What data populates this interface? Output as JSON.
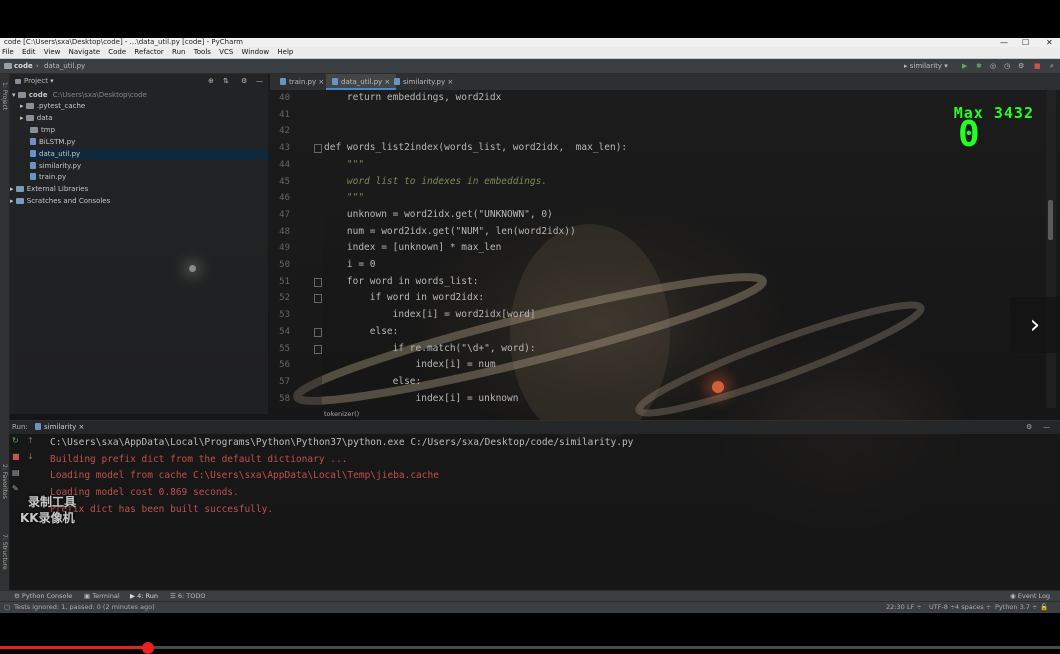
{
  "window": {
    "title": "code [C:\\Users\\sxa\\Desktop\\code] - ...\\data_util.py [code] - PyCharm",
    "controls": [
      "—",
      "☐",
      "✕"
    ]
  },
  "menu": [
    "File",
    "Edit",
    "View",
    "Navigate",
    "Code",
    "Refactor",
    "Run",
    "Tools",
    "VCS",
    "Window",
    "Help"
  ],
  "nav": {
    "breadcrumb": [
      "code",
      "data_util.py"
    ],
    "run_config": "similarity"
  },
  "project": {
    "header": "Project",
    "root_name": "code",
    "root_path": "C:\\Users\\sxa\\Desktop\\code",
    "items": [
      ".pytest_cache",
      "data",
      "tmp",
      "BiLSTM.py",
      "data_util.py",
      "similarity.py",
      "train.py"
    ],
    "external": "External Libraries",
    "scratches": "Scratches and Consoles"
  },
  "tabs": [
    "train.py",
    "data_util.py",
    "similarity.py"
  ],
  "editor": {
    "line_numbers": [
      "40",
      "41",
      "42",
      "43",
      "44",
      "45",
      "46",
      "47",
      "48",
      "49",
      "50",
      "51",
      "52",
      "53",
      "54",
      "55",
      "56",
      "57",
      "58"
    ],
    "lines": [
      "    return embeddings, word2idx",
      "",
      "",
      "def words_list2index(words_list, word2idx,  max_len):",
      "    \"\"\"",
      "    word list to indexes in embeddings.",
      "    \"\"\"",
      "    unknown = word2idx.get(\"UNKNOWN\", 0)",
      "    num = word2idx.get(\"NUM\", len(word2idx))",
      "    index = [unknown] * max_len",
      "    i = 0",
      "    for word in words_list:",
      "        if word in word2idx:",
      "            index[i] = word2idx[word]",
      "        else:",
      "            if re.match(\"\\d+\", word):",
      "                index[i] = num",
      "            else:",
      "                index[i] = unknown"
    ],
    "breadcrumb_bottom": "tokenizer()"
  },
  "run": {
    "label": "Run:",
    "config": "similarity",
    "output": [
      {
        "text": "C:\\Users\\sxa\\AppData\\Local\\Programs\\Python\\Python37\\python.exe C:/Users/sxa/Desktop/code/similarity.py",
        "color": "#bdbdbd"
      },
      {
        "text": "Building prefix dict from the default dictionary ...",
        "color": "#c0504d"
      },
      {
        "text": "Loading model from cache C:\\Users\\sxa\\AppData\\Local\\Temp\\jieba.cache",
        "color": "#c0504d"
      },
      {
        "text": "Loading model cost 0.869 seconds.",
        "color": "#c0504d"
      },
      {
        "text": "Prefix dict has been built succesfully.",
        "color": "#c0504d"
      }
    ]
  },
  "bottom_tabs": [
    "Python Console",
    "Terminal",
    "4: Run",
    "6: TODO"
  ],
  "event_log": "Event Log",
  "status": {
    "message": "Tests ignored: 1, passed: 0 (2 minutes ago)",
    "position": "22:30",
    "line_sep": "LF ÷",
    "encoding": "UTF-8 ÷",
    "indent": "4 spaces ÷",
    "interpreter": "Python 3.7 ÷"
  },
  "overlay": {
    "max_label": "Max 3432",
    "score": "0"
  },
  "watermark": [
    "录制工具",
    "KK录像机"
  ],
  "video": {
    "progress": 0.14
  }
}
